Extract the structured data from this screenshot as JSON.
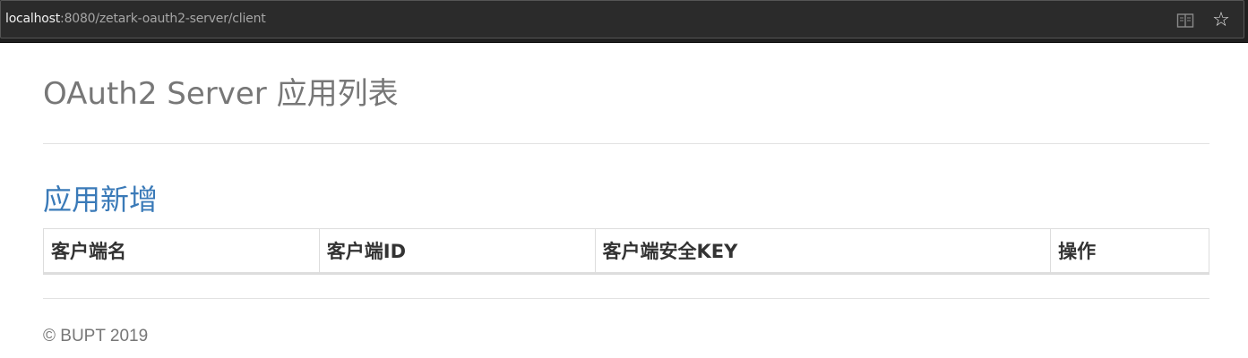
{
  "browser": {
    "url_host": "localhost",
    "url_rest": ":8080/zetark-oauth2-server/client",
    "reader_icon": "reading-view-icon",
    "favorite_icon": "star-icon",
    "favorite_glyph": "☆"
  },
  "page": {
    "title": "OAuth2 Server 应用列表",
    "add_link_label": "应用新增",
    "link_color": "#3a7ab8"
  },
  "table": {
    "columns": [
      "客户端名",
      "客户端ID",
      "客户端安全KEY",
      "操作"
    ],
    "rows": []
  },
  "footer": {
    "copyright": "© BUPT 2019"
  }
}
